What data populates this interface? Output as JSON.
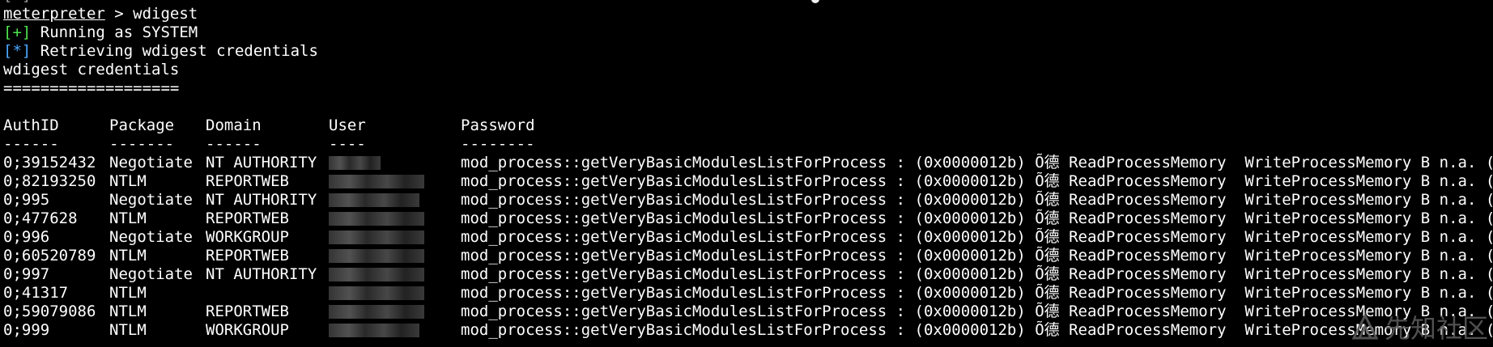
{
  "terminal": {
    "cut_top_text": "[+] ...................................",
    "prompt": {
      "name": "meterpreter",
      "separator": " > ",
      "command": "wdigest"
    },
    "messages": [
      {
        "tag": "[+]",
        "text": " Running as SYSTEM"
      },
      {
        "tag": "[*]",
        "text": " Retrieving wdigest credentials"
      }
    ],
    "section_title": "wdigest credentials",
    "section_rule": "===================",
    "table": {
      "headers": [
        "AuthID",
        "Package",
        "Domain",
        "User",
        "Password"
      ],
      "separators": [
        "------",
        "-------",
        "------",
        "----",
        "--------"
      ],
      "rows": [
        {
          "authid": "0;39152432",
          "package": "Negotiate",
          "domain": "NT AUTHORITY",
          "password": "mod_process::getVeryBasicModulesListForProcess : (0x0000012b) Õ德 ReadProcessMemory  WriteProcessMemory B n.a. (wdigest"
        },
        {
          "authid": "0;82193250",
          "package": "NTLM",
          "domain": "REPORTWEB",
          "password": "mod_process::getVeryBasicModulesListForProcess : (0x0000012b) Õ德 ReadProcessMemory  WriteProcessMemory B n.a. (wdigest"
        },
        {
          "authid": "0;995",
          "package": "Negotiate",
          "domain": "NT AUTHORITY",
          "password": "mod_process::getVeryBasicModulesListForProcess : (0x0000012b) Õ德 ReadProcessMemory  WriteProcessMemory B n.a. (wdigest"
        },
        {
          "authid": "0;477628",
          "package": "NTLM",
          "domain": "REPORTWEB",
          "password": "mod_process::getVeryBasicModulesListForProcess : (0x0000012b) Õ德 ReadProcessMemory  WriteProcessMemory B n.a. (wdigest"
        },
        {
          "authid": "0;996",
          "package": "Negotiate",
          "domain": "WORKGROUP",
          "password": "mod_process::getVeryBasicModulesListForProcess : (0x0000012b) Õ德 ReadProcessMemory  WriteProcessMemory B n.a. (wdigest"
        },
        {
          "authid": "0;60520789",
          "package": "NTLM",
          "domain": "REPORTWEB",
          "password": "mod_process::getVeryBasicModulesListForProcess : (0x0000012b) Õ德 ReadProcessMemory  WriteProcessMemory B n.a. (wdigest"
        },
        {
          "authid": "0;997",
          "package": "Negotiate",
          "domain": "NT AUTHORITY",
          "password": "mod_process::getVeryBasicModulesListForProcess : (0x0000012b) Õ德 ReadProcessMemory  WriteProcessMemory B n.a. (wdigest"
        },
        {
          "authid": "0;41317",
          "package": "NTLM",
          "domain": "",
          "password": "mod_process::getVeryBasicModulesListForProcess : (0x0000012b) Õ德 ReadProcessMemory  WriteProcessMemory B n.a. (wdigest"
        },
        {
          "authid": "0;59079086",
          "package": "NTLM",
          "domain": "REPORTWEB",
          "password": "mod_process::getVeryBasicModulesListForProcess : (0x0000012b) Õ德 ReadProcessMemory  WriteProcessMemory B n.a. (wdigest"
        },
        {
          "authid": "0;999",
          "package": "NTLM",
          "domain": "WORKGROUP",
          "password": "mod_process::getVeryBasicModulesListForProcess : (0x0000012b) Õ德 ReadProcessMemory  WriteProcessMemory B n.a. (wdigest"
        }
      ]
    }
  },
  "watermark": {
    "icon": "xianzhi-logo-icon",
    "text": "先知社区"
  },
  "colors": {
    "background": "#000000",
    "text": "#ffffff",
    "success_tag": "#4ee44e",
    "info_tag": "#4aa8ff"
  }
}
